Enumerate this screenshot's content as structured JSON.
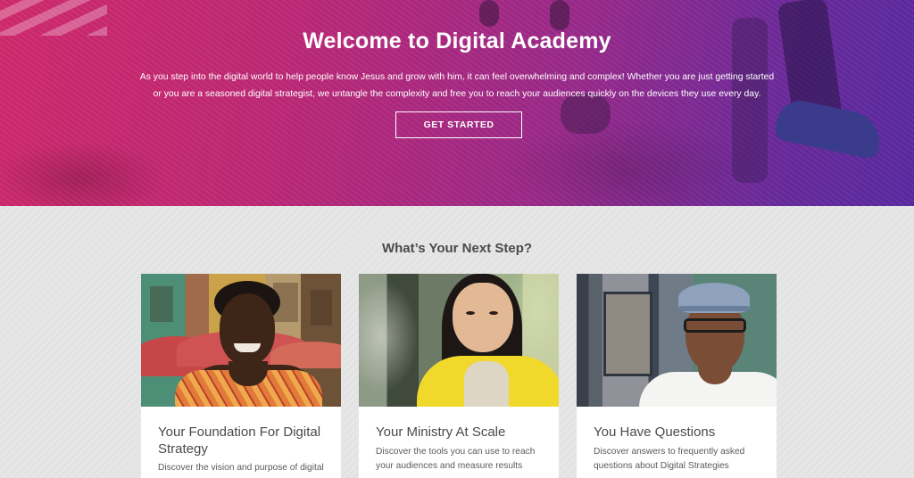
{
  "hero": {
    "title": "Welcome to Digital Academy",
    "description": "As you step into the digital world to help people know Jesus and grow with him, it can feel overwhelming and complex! Whether you are just getting started or you are a seasoned digital strategist, we untangle the complexity and free you to reach your audiences quickly on the devices they use every day.",
    "cta_label": "GET STARTED",
    "gradient_colors": [
      "#d12a6d",
      "#9a2a8c",
      "#5a2aa3"
    ]
  },
  "next_step": {
    "heading": "What’s Your Next Step?",
    "cards": [
      {
        "title": "Your Foundation For Digital Strategy",
        "description": "Discover the vision and purpose of digital",
        "image": "woman-smiling-street-photo"
      },
      {
        "title": "Your Ministry At Scale",
        "description": "Discover the tools you can use to reach your audiences and measure results",
        "image": "woman-yellow-cardigan-photo"
      },
      {
        "title": "You Have Questions",
        "description": "Discover answers to frequently asked questions about Digital Strategies",
        "image": "man-cap-glasses-photo"
      }
    ]
  }
}
